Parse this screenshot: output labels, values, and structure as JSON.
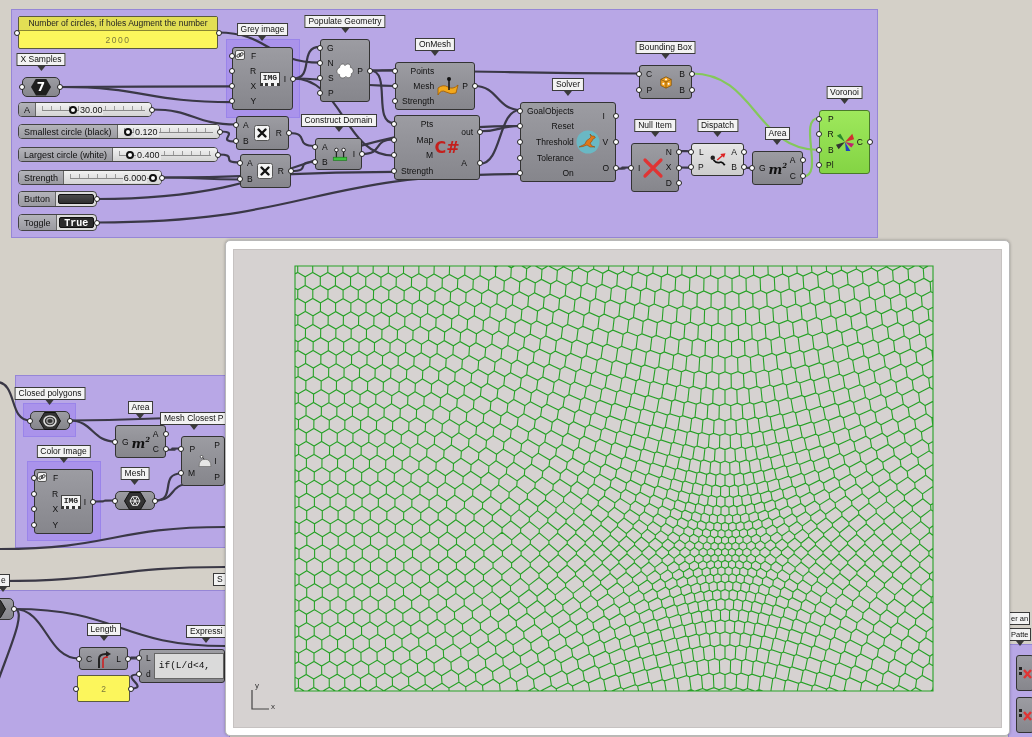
{
  "nodes": [
    {
      "kind": "panel",
      "header": "Number of circles, if holes Augment the number",
      "value": "2000",
      "selected": false
    },
    {
      "kind": "param",
      "label": "X Samples",
      "value": "7",
      "selected": false
    },
    {
      "kind": "slider",
      "name": "A",
      "value": "30.00",
      "level": 0.3,
      "selected": false
    },
    {
      "kind": "slider",
      "name": "Smallest circle (black)",
      "value": "0.120",
      "level": 0.05,
      "selected": false
    },
    {
      "kind": "slider",
      "name": "Largest circle (white)",
      "value": "0.400",
      "level": 0.12,
      "selected": false
    },
    {
      "kind": "slider",
      "name": "Strength",
      "value": "6.000",
      "level": 0.98,
      "selected": false
    },
    {
      "kind": "button",
      "name": "Button",
      "selected": false
    },
    {
      "kind": "toggle",
      "name": "Toggle",
      "value": "True",
      "selected": false
    },
    {
      "kind": "component",
      "label": "Grey image",
      "inputs": [
        "F",
        "R",
        "X",
        "Y"
      ],
      "outputs": [
        "I"
      ],
      "icon_text": "IMG",
      "preview": false,
      "selected": false
    },
    {
      "kind": "component",
      "inputs": [
        "A",
        "B"
      ],
      "outputs": [
        "R"
      ],
      "preview": false,
      "selected": false
    },
    {
      "kind": "component",
      "inputs": [
        "A",
        "B"
      ],
      "outputs": [
        "R"
      ],
      "preview": false,
      "selected": false
    },
    {
      "kind": "component",
      "label": "Populate Geometry",
      "inputs": [
        "G",
        "N",
        "S",
        "P"
      ],
      "outputs": [
        "P"
      ],
      "preview": false,
      "selected": false
    },
    {
      "kind": "component",
      "label": "Construct Domain",
      "inputs": [
        "A",
        "B"
      ],
      "outputs": [
        "I"
      ],
      "preview": false,
      "selected": false
    },
    {
      "kind": "component",
      "label": "OnMesh",
      "inputs": [
        "Points",
        "Mesh",
        "Strength"
      ],
      "outputs": [
        "P"
      ],
      "preview": false,
      "selected": false
    },
    {
      "kind": "component",
      "inputs": [
        "Pts",
        "Map",
        "M",
        "Strength"
      ],
      "outputs": [
        "out",
        "A"
      ],
      "icon_text": "C#",
      "preview": false,
      "selected": false
    },
    {
      "kind": "component",
      "label": "Solver",
      "inputs": [
        "GoalObjects",
        "Reset",
        "Threshold",
        "Tolerance",
        "On"
      ],
      "outputs": [
        "I",
        "V",
        "O"
      ],
      "preview": false,
      "selected": false
    },
    {
      "kind": "component",
      "label": "Bounding Box",
      "inputs": [
        "C",
        "P"
      ],
      "outputs": [
        "B",
        "B"
      ],
      "preview": false,
      "selected": false
    },
    {
      "kind": "component",
      "label": "Null Item",
      "inputs": [
        "I"
      ],
      "outputs": [
        "N",
        "X",
        "D"
      ],
      "preview": false,
      "selected": false
    },
    {
      "kind": "component",
      "label": "Dispatch",
      "inputs": [
        "L",
        "P"
      ],
      "outputs": [
        "A",
        "B"
      ],
      "preview": true,
      "selected": false
    },
    {
      "kind": "component",
      "label": "Area",
      "inputs": [
        "G"
      ],
      "outputs": [
        "A",
        "C"
      ],
      "icon_text": "m$^{2}$",
      "preview": false,
      "selected": false
    },
    {
      "kind": "component",
      "label": "Voronoi",
      "inputs": [
        "P",
        "R",
        "B",
        "Pl"
      ],
      "outputs": [
        "C"
      ],
      "preview": true,
      "selected": true
    },
    {
      "kind": "param",
      "label": "Closed polygons",
      "selected": false
    },
    {
      "kind": "component",
      "label": "Area",
      "inputs": [
        "G"
      ],
      "outputs": [
        "A",
        "C"
      ],
      "icon_text": "m$^{2}$",
      "preview": false,
      "selected": false
    },
    {
      "kind": "component",
      "label": "Mesh Closest P",
      "inputs": [
        "P",
        "M"
      ],
      "outputs": [
        "P",
        "I",
        "P"
      ],
      "preview": false,
      "selected": false
    },
    {
      "kind": "component",
      "label": "Color Image",
      "inputs": [
        "F",
        "R",
        "X",
        "Y"
      ],
      "outputs": [
        "I"
      ],
      "icon_text": "IMG",
      "preview": false,
      "selected": false
    },
    {
      "kind": "param",
      "label": "Mesh",
      "selected": false
    },
    {
      "kind": "param",
      "label": "e",
      "selected": false
    },
    {
      "kind": "tag",
      "label": "S"
    },
    {
      "kind": "component",
      "label": "Length",
      "inputs": [
        "C"
      ],
      "outputs": [
        "L"
      ],
      "preview": false,
      "selected": false
    },
    {
      "kind": "panel",
      "value": "2",
      "selected": false
    },
    {
      "kind": "expression",
      "label": "Expressi",
      "inputs": [
        "L",
        "d"
      ],
      "expression": "if(L/d<4,",
      "selected": false
    },
    {
      "kind": "tag",
      "label": "er an"
    },
    {
      "kind": "component",
      "label": "Patte",
      "preview": false,
      "selected": false
    },
    {
      "kind": "component",
      "preview": false,
      "selected": false
    }
  ],
  "viewport": {
    "y_axis": "y",
    "x_axis": "x"
  }
}
